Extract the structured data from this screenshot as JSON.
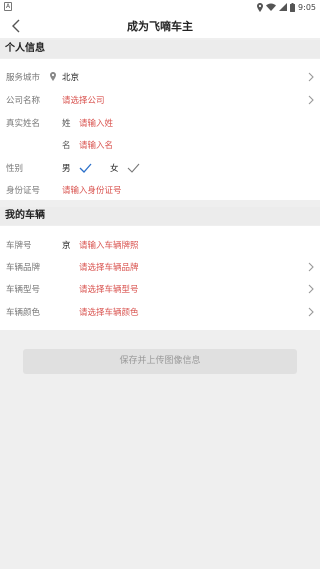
{
  "status_bar": {
    "left_icon_text": "A",
    "time": "9:05"
  },
  "nav": {
    "title": "成为飞嘀车主"
  },
  "personal_section": {
    "title": "个人信息",
    "city": {
      "label": "服务城市",
      "value": "北京"
    },
    "company": {
      "label": "公司名称",
      "placeholder": "请选择公司"
    },
    "real_name": {
      "label": "真实姓名",
      "surname_label": "姓",
      "surname_placeholder": "请输入姓",
      "given_label": "名",
      "given_placeholder": "请输入名"
    },
    "gender": {
      "label": "性别",
      "options": [
        "男",
        "女"
      ],
      "selected": "男"
    },
    "id_number": {
      "label": "身份证号",
      "placeholder": "请输入身份证号"
    }
  },
  "vehicle_section": {
    "title": "我的车辆",
    "plate": {
      "label": "车牌号",
      "prefix": "京",
      "placeholder": "请输入车辆牌照"
    },
    "brand": {
      "label": "车辆品牌",
      "placeholder": "请选择车辆品牌"
    },
    "model": {
      "label": "车辆型号",
      "placeholder": "请选择车辆型号"
    },
    "color": {
      "label": "车辆颜色",
      "placeholder": "请选择车辆颜色"
    }
  },
  "actions": {
    "save_label": "保存并上传图像信息"
  },
  "colors": {
    "accent_red": "#d9534f",
    "check_blue": "#2a6fc9",
    "check_gray": "#777777"
  },
  "icons": [
    "back-arrow-icon",
    "location-pin-icon",
    "chevron-right-icon",
    "checkmark-icon",
    "wifi-icon",
    "battery-icon"
  ]
}
